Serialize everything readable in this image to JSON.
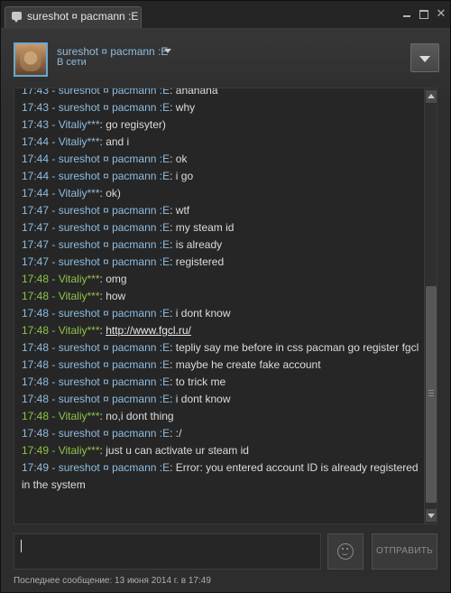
{
  "window": {
    "tab_title": "sureshot ¤ pacmann :E",
    "minimize_glyph": "",
    "close_glyph": "✕"
  },
  "header": {
    "contact_name": "sureshot ¤ pacmann :E",
    "status": "В сети"
  },
  "messages": [
    {
      "time": "17:43",
      "sender": "sureshot ¤ pacmann :E",
      "sender_color": "blue",
      "text": "ahahaha",
      "link": ""
    },
    {
      "time": "17:43",
      "sender": "sureshot ¤ pacmann :E",
      "sender_color": "blue",
      "text": "why",
      "link": ""
    },
    {
      "time": "17:43",
      "sender": "Vitaliy***",
      "sender_color": "gray",
      "text": "go regisyter)",
      "link": ""
    },
    {
      "time": "17:44",
      "sender": "Vitaliy***",
      "sender_color": "gray",
      "text": "and i",
      "link": ""
    },
    {
      "time": "17:44",
      "sender": "sureshot ¤ pacmann :E",
      "sender_color": "blue",
      "text": "ok",
      "link": ""
    },
    {
      "time": "17:44",
      "sender": "sureshot ¤ pacmann :E",
      "sender_color": "blue",
      "text": "i go",
      "link": ""
    },
    {
      "time": "17:44",
      "sender": "Vitaliy***",
      "sender_color": "gray",
      "text": "ok)",
      "link": ""
    },
    {
      "time": "17:47",
      "sender": "sureshot ¤ pacmann :E",
      "sender_color": "blue",
      "text": "wtf",
      "link": ""
    },
    {
      "time": "17:47",
      "sender": "sureshot ¤ pacmann :E",
      "sender_color": "blue",
      "text": "my steam id",
      "link": ""
    },
    {
      "time": "17:47",
      "sender": "sureshot ¤ pacmann :E",
      "sender_color": "blue",
      "text": "is already",
      "link": ""
    },
    {
      "time": "17:47",
      "sender": "sureshot ¤ pacmann :E",
      "sender_color": "blue",
      "text": "registered",
      "link": ""
    },
    {
      "time": "17:48",
      "sender": "Vitaliy***",
      "sender_color": "green",
      "text": "omg",
      "link": ""
    },
    {
      "time": "17:48",
      "sender": "Vitaliy***",
      "sender_color": "green",
      "text": "how",
      "link": ""
    },
    {
      "time": "17:48",
      "sender": "sureshot ¤ pacmann :E",
      "sender_color": "blue",
      "text": "i dont know",
      "link": ""
    },
    {
      "time": "17:48",
      "sender": "Vitaliy***",
      "sender_color": "green",
      "text": "",
      "link": "http://www.fgcl.ru/"
    },
    {
      "time": "17:48",
      "sender": "sureshot ¤ pacmann :E",
      "sender_color": "blue",
      "text": "tepliy say me before in css pacman go register fgcl",
      "link": ""
    },
    {
      "time": "17:48",
      "sender": "sureshot ¤ pacmann :E",
      "sender_color": "blue",
      "text": "maybe he create fake account",
      "link": ""
    },
    {
      "time": "17:48",
      "sender": "sureshot ¤ pacmann :E",
      "sender_color": "blue",
      "text": "to trick me",
      "link": ""
    },
    {
      "time": "17:48",
      "sender": "sureshot ¤ pacmann :E",
      "sender_color": "blue",
      "text": "i dont know",
      "link": ""
    },
    {
      "time": "17:48",
      "sender": "Vitaliy***",
      "sender_color": "green",
      "text": "no,i dont thing",
      "link": ""
    },
    {
      "time": "17:48",
      "sender": "sureshot ¤ pacmann :E",
      "sender_color": "blue",
      "text": ":/",
      "link": ""
    },
    {
      "time": "17:49",
      "sender": "Vitaliy***",
      "sender_color": "green",
      "text": "just u can activate ur steam id",
      "link": ""
    },
    {
      "time": "17:49",
      "sender": "sureshot ¤ pacmann :E",
      "sender_color": "blue",
      "text": "Error: you entered account ID is already registered in the system",
      "link": ""
    }
  ],
  "composer": {
    "text": "",
    "send_label": "ОТПРАВИТЬ"
  },
  "footer": {
    "last_message": "Последнее сообщение: 13 июня 2014 г. в 17:49"
  },
  "colors": {
    "blue_name": "#8fbde0",
    "green_name": "#8fc248",
    "background": "#2d2d2d",
    "chat_background": "#262626"
  }
}
